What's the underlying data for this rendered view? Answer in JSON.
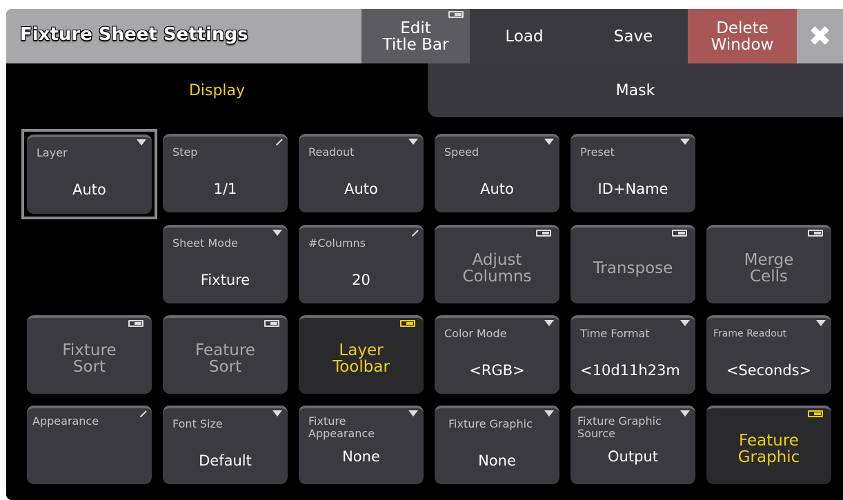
{
  "window": {
    "title": "Fixture Sheet Settings",
    "buttons": {
      "edit_title_bar": "Edit\nTitle Bar",
      "load": "Load",
      "save": "Save",
      "delete_window": "Delete\nWindow",
      "close_icon": "✖"
    }
  },
  "tabs": {
    "display": "Display",
    "mask": "Mask"
  },
  "settings": {
    "layer": {
      "label": "Layer",
      "value": "Auto"
    },
    "step": {
      "label": "Step",
      "value": "1/1"
    },
    "readout": {
      "label": "Readout",
      "value": "Auto"
    },
    "speed": {
      "label": "Speed",
      "value": "Auto"
    },
    "preset": {
      "label": "Preset",
      "value": "ID+Name"
    },
    "sheet_mode": {
      "label": "Sheet Mode",
      "value": "Fixture"
    },
    "columns": {
      "label": "#Columns",
      "value": "20"
    },
    "adjust_columns": {
      "label": "Adjust\nColumns"
    },
    "transpose": {
      "label": "Transpose"
    },
    "merge_cells": {
      "label": "Merge\nCells"
    },
    "fixture_sort": {
      "label": "Fixture\nSort"
    },
    "feature_sort": {
      "label": "Feature\nSort"
    },
    "layer_toolbar": {
      "label": "Layer\nToolbar"
    },
    "color_mode": {
      "label": "Color Mode",
      "value": "<RGB>"
    },
    "time_format": {
      "label": "Time Format",
      "value": "<10d11h23m"
    },
    "frame_readout": {
      "label": "Frame Readout",
      "value": "<Seconds>"
    },
    "appearance": {
      "label": "Appearance"
    },
    "font_size": {
      "label": "Font Size",
      "value": "Default"
    },
    "fixture_appearance": {
      "label": "Fixture\nAppearance",
      "value": "None"
    },
    "fixture_graphic": {
      "label": "Fixture Graphic",
      "value": "None"
    },
    "fixture_graphic_source": {
      "label": "Fixture Graphic\nSource",
      "value": "Output"
    },
    "feature_graphic": {
      "label": "Feature\nGraphic"
    }
  },
  "colors": {
    "accent_yellow": "#f0cc1a",
    "delete_red": "#a85656",
    "title_bar_gray": "#a8a8aa",
    "button_gray": "#3b3b3f"
  }
}
